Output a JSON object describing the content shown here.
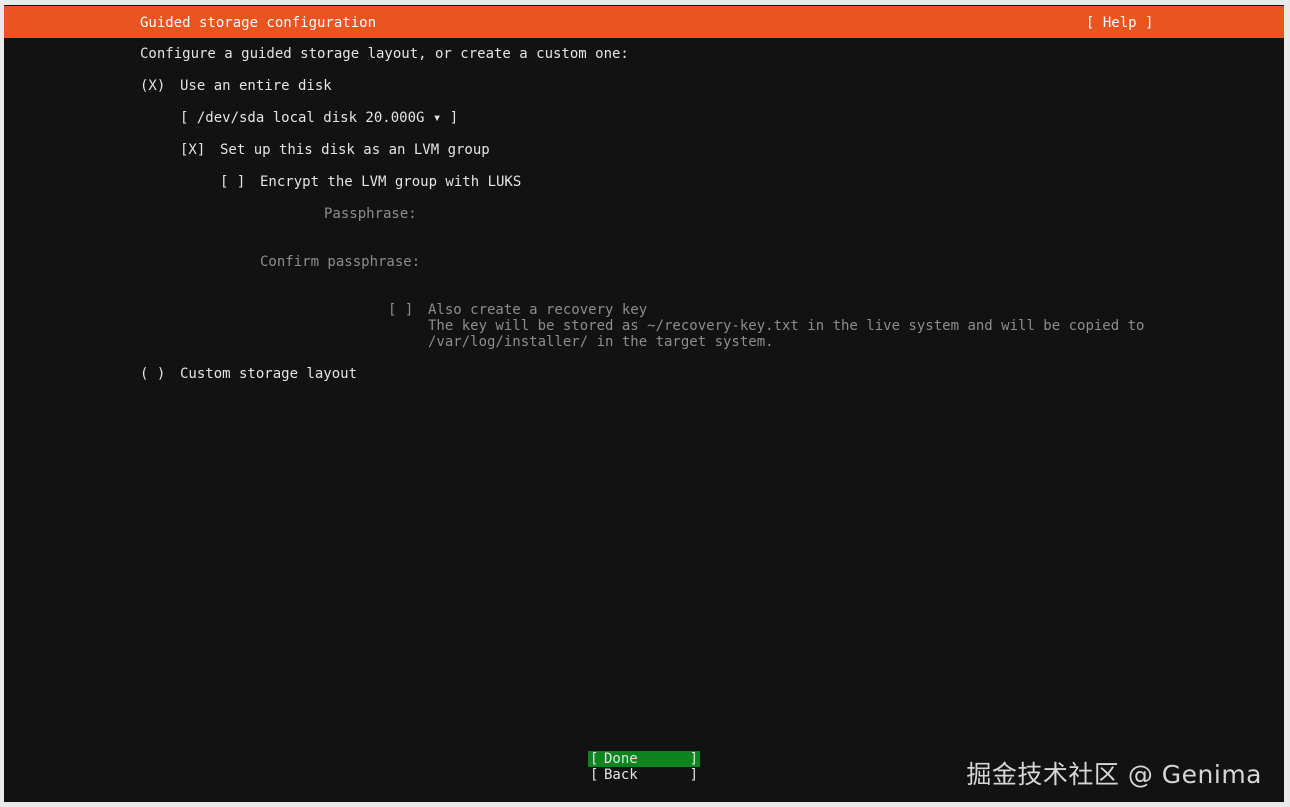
{
  "header": {
    "title": "Guided storage configuration",
    "help": "[ Help ]"
  },
  "intro": "Configure a guided storage layout, or create a custom one:",
  "entire_disk": {
    "radio": "(X)",
    "label": "Use an entire disk",
    "disk_select": "[ /dev/sda local disk 20.000G ▾ ]",
    "lvm_checkbox": "[X]",
    "lvm_label": "Set up this disk as an LVM group",
    "luks_checkbox": "[ ]",
    "luks_label": "Encrypt the LVM group with LUKS",
    "passphrase_label": "Passphrase:",
    "confirm_label": "Confirm passphrase:",
    "recovery_checkbox": "[ ]",
    "recovery_label": "Also create a recovery key",
    "recovery_desc_1": "The key will be stored as ~/recovery-key.txt in the live system and will be copied to",
    "recovery_desc_2": "/var/log/installer/ in the target system."
  },
  "custom": {
    "radio": "( )",
    "label": "Custom storage layout"
  },
  "buttons": {
    "done": "Done",
    "back": "Back",
    "open": "[",
    "close": "]"
  },
  "watermark": "掘金技术社区 @ Genima"
}
